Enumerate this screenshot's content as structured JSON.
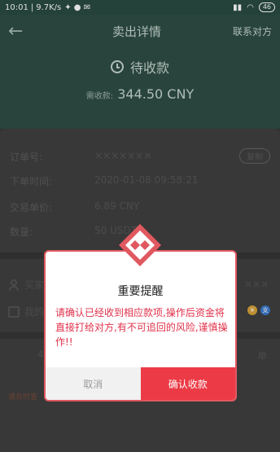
{
  "status_bar": {
    "time": "10:01",
    "speed": "9.7K/s",
    "battery": "46"
  },
  "header": {
    "back_icon": "back-arrow-icon",
    "title": "卖出详情",
    "contact": "联系对方",
    "status": "待收款",
    "amount_label": "需收款:",
    "amount_value": "344.50 CNY"
  },
  "order": {
    "order_no_label": "订单号:",
    "order_no_value": "×××××××",
    "copy_label": "复制",
    "time_label": "下单时间:",
    "time_value": "2020-01-08 09:58:21",
    "price_label": "交易单价:",
    "price_value": "6.89 CNY",
    "quantity_label": "数量:",
    "quantity_value": "50 USDT"
  },
  "buyer": {
    "buyer_label": "买家",
    "buyer_name": "×××",
    "account_label": "我的",
    "pay_icons": [
      "wallet-icon",
      "alipay-icon"
    ],
    "fragment_left": "4",
    "fragment_right": "单",
    "notice": "请及时查"
  },
  "dialog": {
    "title": "重要提醒",
    "message": "请确认已经收到相应款项,操作后资金将直接打给对方,有不可追回的风险,谨慎操作!!",
    "cancel": "取消",
    "confirm": "确认收款",
    "accent": "#ec3b46"
  }
}
